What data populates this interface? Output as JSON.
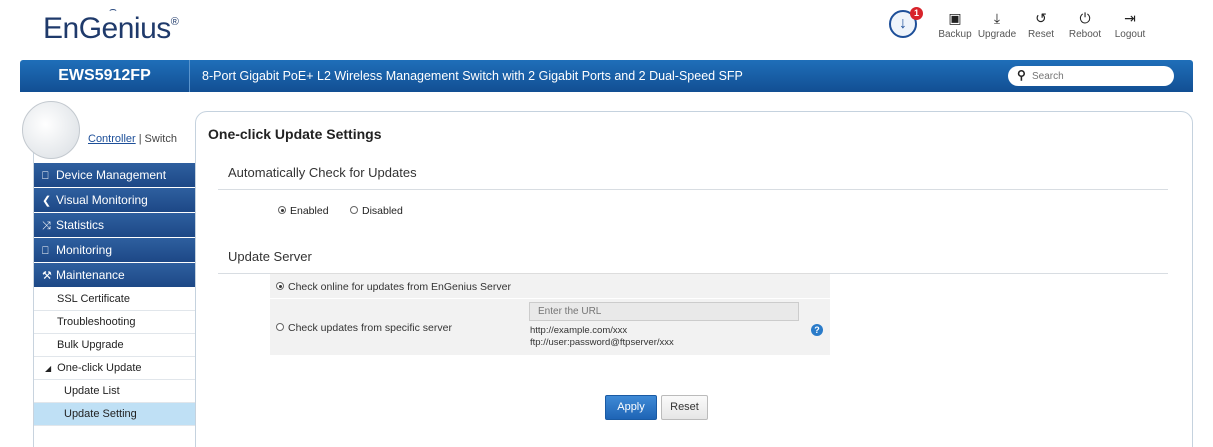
{
  "header": {
    "logo": "EnGenius",
    "logo_mark": "®",
    "alert_count": "1",
    "tools": [
      {
        "label": "Backup",
        "icon": "save-icon"
      },
      {
        "label": "Upgrade",
        "icon": "upgrade-icon"
      },
      {
        "label": "Reset",
        "icon": "reset-icon"
      },
      {
        "label": "Reboot",
        "icon": "power-icon"
      },
      {
        "label": "Logout",
        "icon": "logout-icon"
      }
    ]
  },
  "topbar": {
    "model": "EWS5912FP",
    "description": "8-Port Gigabit PoE+ L2 Wireless Management Switch with 2 Gigabit Ports and 2 Dual-Speed SFP",
    "search_placeholder": "Search"
  },
  "sidebar": {
    "controller": "Controller",
    "separator": "|",
    "switch": "Switch",
    "categories": [
      {
        "label": "Device Management",
        "icon": "device-icon"
      },
      {
        "label": "Visual Monitoring",
        "icon": "share-icon"
      },
      {
        "label": "Statistics",
        "icon": "shuffle-icon"
      },
      {
        "label": "Monitoring",
        "icon": "monitor-icon"
      },
      {
        "label": "Maintenance",
        "icon": "wrench-icon"
      }
    ],
    "items": [
      "SSL Certificate",
      "Troubleshooting",
      "Bulk Upgrade",
      "One-click Update",
      "Update List",
      "Update Setting"
    ]
  },
  "main": {
    "title": "One-click Update Settings",
    "auto_check": {
      "heading": "Automatically Check for Updates",
      "enabled": "Enabled",
      "disabled": "Disabled",
      "selected": "Enabled"
    },
    "update_server": {
      "heading": "Update Server",
      "option_engenius": "Check online for updates from EnGenius Server",
      "option_specific": "Check updates from specific server",
      "url_placeholder": "Enter the URL",
      "hint1": "http://example.com/xxx",
      "hint2": "ftp://user:password@ftpserver/xxx",
      "help": "?"
    },
    "apply": "Apply",
    "reset": "Reset"
  },
  "colors": {
    "brand_blue": "#1d4f99",
    "bar_blue": "#1f6fb9",
    "active_item": "#bfe0f5",
    "alert_red": "#d8232a"
  }
}
